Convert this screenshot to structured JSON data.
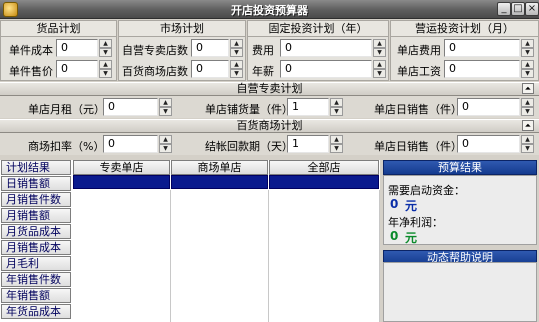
{
  "window": {
    "title": "开店投资预算器"
  },
  "groups": {
    "goods": {
      "title": "货品计划",
      "fields": [
        {
          "label": "单件成本",
          "value": "0"
        },
        {
          "label": "单件售价",
          "value": "0"
        }
      ]
    },
    "market": {
      "title": "市场计划",
      "fields": [
        {
          "label": "自营专卖店数",
          "value": "0"
        },
        {
          "label": "百货商场店数",
          "value": "0"
        }
      ]
    },
    "fixed": {
      "title": "固定投资计划（年）",
      "fields": [
        {
          "label": "费用",
          "value": "0"
        },
        {
          "label": "年薪",
          "value": "0"
        }
      ]
    },
    "operating": {
      "title": "营运投资计划（月）",
      "fields": [
        {
          "label": "单店费用",
          "value": "0"
        },
        {
          "label": "单店工资",
          "value": "0"
        }
      ]
    }
  },
  "self_store_plan": {
    "title": "自营专卖计划",
    "fields": [
      {
        "label": "单店月租（元）",
        "value": "0"
      },
      {
        "label": "单店铺货量（件）",
        "value": "1"
      },
      {
        "label": "单店日销售（件）",
        "value": "0"
      }
    ]
  },
  "mall_plan": {
    "title": "百货商场计划",
    "fields": [
      {
        "label": "商场扣率（%）",
        "value": "0"
      },
      {
        "label": "结帐回款期（天）",
        "value": "1"
      },
      {
        "label": "单店日销售（件）",
        "value": "0"
      }
    ]
  },
  "grid": {
    "corner": "计划结果",
    "columns": [
      "专卖单店",
      "商场单店",
      "全部店"
    ],
    "rows": [
      "日销售额",
      "月销售件数",
      "月销售额",
      "月货品成本",
      "月销售成本",
      "月毛利",
      "年销售件数",
      "年销售额",
      "年货品成本"
    ]
  },
  "budget_result": {
    "title": "预算结果",
    "startup_label": "需要启动资金：",
    "startup_value": "0",
    "startup_unit": "元",
    "profit_label": "年净利润：",
    "profit_value": "0",
    "profit_unit": "元"
  },
  "help": {
    "title": "动态帮助说明"
  },
  "icons": {
    "collapse": "double-chevron-up-icon",
    "spin_up": "triangle-up-icon",
    "spin_down": "triangle-down-icon"
  }
}
